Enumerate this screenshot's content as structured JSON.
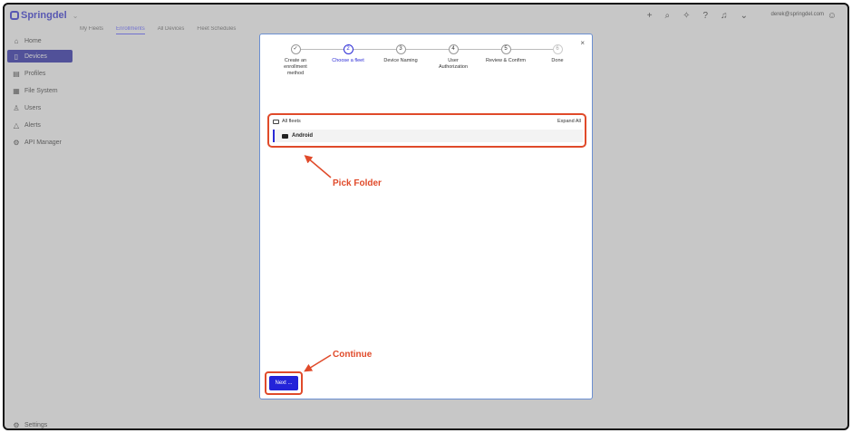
{
  "app": {
    "brand": "Springdel",
    "email": "derek@springdel.com"
  },
  "sidebar": {
    "items": [
      {
        "label": "Home",
        "icon": "home-icon"
      },
      {
        "label": "Devices",
        "icon": "device-icon"
      },
      {
        "label": "Profiles",
        "icon": "profile-icon"
      },
      {
        "label": "File System",
        "icon": "file-system-icon"
      },
      {
        "label": "Users",
        "icon": "users-icon"
      },
      {
        "label": "Alerts",
        "icon": "bell-icon"
      },
      {
        "label": "API Manager",
        "icon": "gear-icon"
      }
    ],
    "settings": "Settings"
  },
  "tabs": [
    "My Fleets",
    "Enrollments",
    "All Devices",
    "Fleet Schedules"
  ],
  "wizard": {
    "steps": [
      {
        "number": "✓",
        "label": "Create an enrollment method"
      },
      {
        "number": "2",
        "label": "Choose a fleet"
      },
      {
        "number": "3",
        "label": "Device Naming"
      },
      {
        "number": "4",
        "label": "User Authorization"
      },
      {
        "number": "5",
        "label": "Review & Confirm"
      },
      {
        "number": "6",
        "label": "Done"
      }
    ],
    "tree_root": "All fleets",
    "expand_all": "Expand All",
    "tree_item": "Android",
    "next_label": "Next ...",
    "close": "×"
  },
  "annotations": {
    "pick": "Pick Folder",
    "continue": "Continue"
  },
  "colors": {
    "accent": "#2b2bd6",
    "annotation": "#e04a2a",
    "button": "#2323d9"
  }
}
